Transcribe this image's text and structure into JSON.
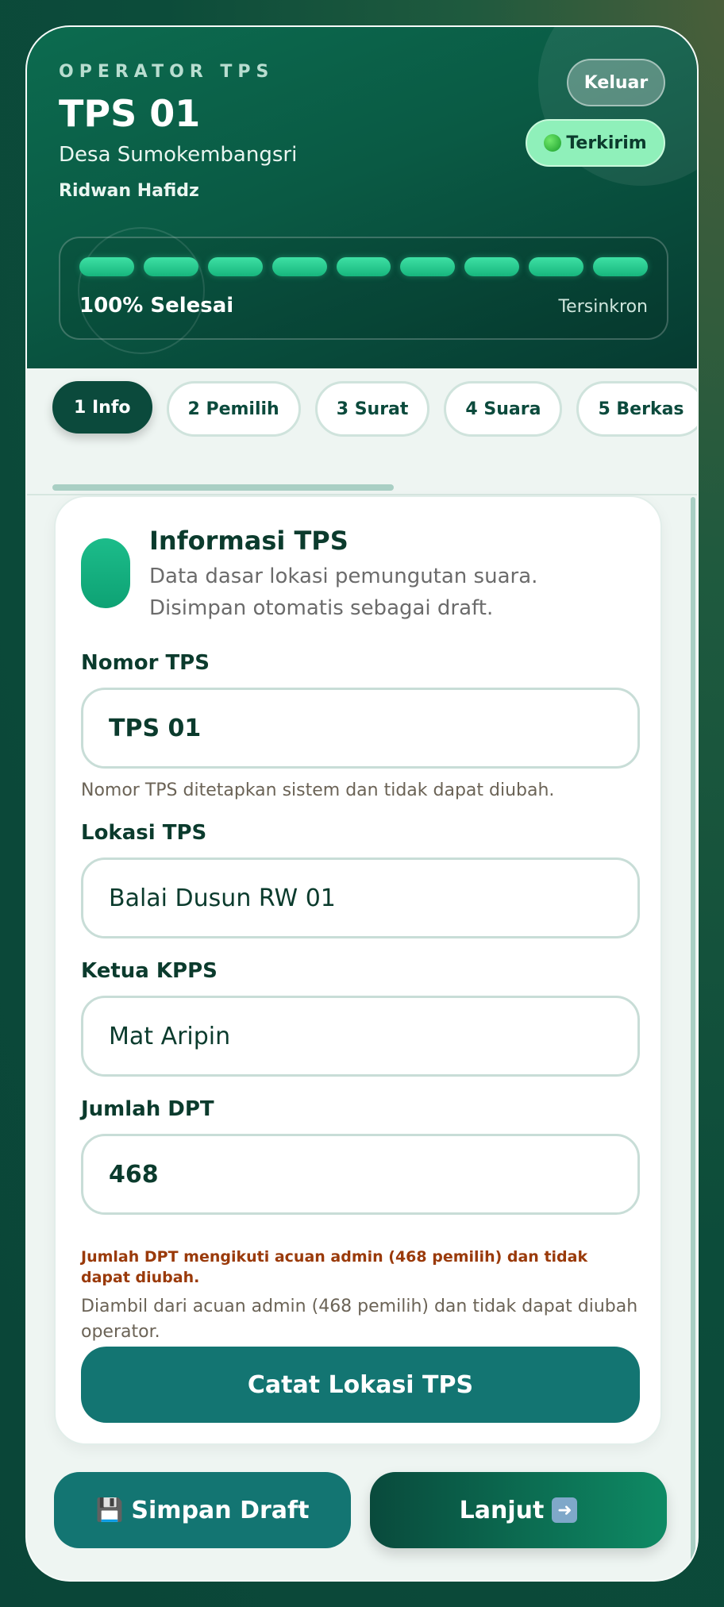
{
  "header": {
    "eyebrow": "OPERATOR TPS",
    "title": "TPS 01",
    "village": "Desa Sumokembangsri",
    "operator": "Ridwan Hafidz",
    "logout_label": "Keluar",
    "status_label": "Terkirim",
    "status_color": "#8ff0ba",
    "progress": {
      "segments_total": 9,
      "segments_done": 9,
      "percent": 100,
      "label": "100% Selesai",
      "sync_label": "Tersinkron"
    }
  },
  "tabs": [
    {
      "label": "1 Info",
      "active": true
    },
    {
      "label": "2 Pemilih",
      "active": false
    },
    {
      "label": "3 Surat",
      "active": false
    },
    {
      "label": "4 Suara",
      "active": false
    },
    {
      "label": "5 Berkas",
      "active": false
    }
  ],
  "card": {
    "title": "Informasi TPS",
    "subtitle": "Data dasar lokasi pemungutan suara. Disimpan otomatis sebagai draft.",
    "fields": {
      "nomor": {
        "label": "Nomor TPS",
        "value": "TPS 01",
        "helper": "Nomor TPS ditetapkan sistem dan tidak dapat diubah."
      },
      "lokasi": {
        "label": "Lokasi TPS",
        "value": "Balai Dusun RW 01"
      },
      "ketua": {
        "label": "Ketua KPPS",
        "value": "Mat Aripin"
      },
      "dpt": {
        "label": "Jumlah DPT",
        "value": "468",
        "warning": "Jumlah DPT mengikuti acuan admin (468 pemilih) dan tidak dapat diubah.",
        "helper": "Diambil dari acuan admin (468 pemilih) dan tidak dapat diubah operator."
      }
    },
    "action_label": "Catat Lokasi TPS"
  },
  "footer": {
    "draft_label": "Simpan Draft",
    "draft_icon": "floppy-disk-icon",
    "next_label": "Lanjut",
    "next_icon": "arrow-right-icon"
  },
  "colors": {
    "primary_dark": "#0b4a3c",
    "teal_button": "#137572",
    "accent_green": "#1cbc8a",
    "warning_text": "#9a3a0a"
  }
}
